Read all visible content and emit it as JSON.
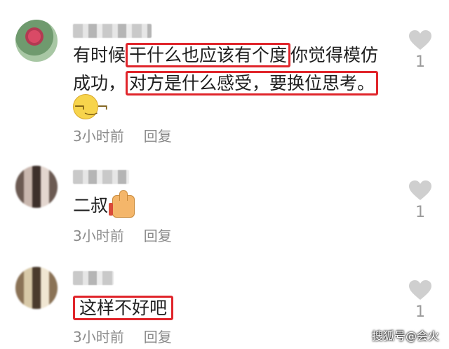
{
  "comments": [
    {
      "line1_pre": "有时候",
      "line1_hl": "干什么也应该有个度",
      "line1_post": "你觉得模仿",
      "line2_pre": "成功，",
      "line2_hl": "对方是什么感受，要换位思考。",
      "time": "3小时前",
      "reply": "回复",
      "likes": "1",
      "emoji_icon": "smirk-emoji"
    },
    {
      "text": "二叔",
      "time": "3小时前",
      "reply": "回复",
      "likes": "1",
      "emoji_icon": "thumbs-up-emoji"
    },
    {
      "text_hl": "这样不好吧",
      "time": "3小时前",
      "reply": "回复",
      "likes": "1"
    }
  ],
  "watermark": "搜狐号@会火",
  "colors": {
    "highlight": "#e0252b",
    "meta": "#8a8a8a",
    "heart": "#c9c9c9"
  }
}
